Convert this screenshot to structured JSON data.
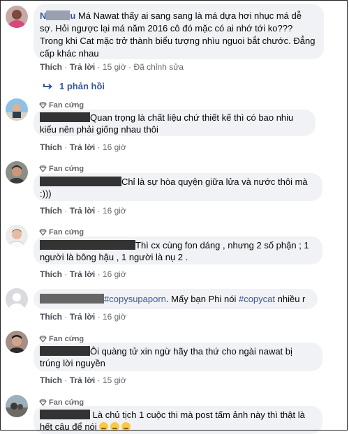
{
  "comments": [
    {
      "text": "Má Nawat thấy ai sang sang là má dựa hơi nhục má dễ sợ. Hỏi ngược lại má năm 2016 cô đó mặc có ai nhớ tới ko??? Trong khi Cat mặc trở thành biểu tượng nhìu nguoi bắt chước. Đẳng cấp khác nhau",
      "name_prefix": "N",
      "name_suffix": "u",
      "like": "Thích",
      "reply": "Trả lời",
      "time": "15 giờ",
      "edited": "Đã chỉnh sửa",
      "reply_count": "1 phản hồi"
    },
    {
      "badge": "Fan cứng",
      "text": "Quan trọng là chất liệu chứ thiết kế thì có bao nhiu kiểu nên phải giống nhau thôi",
      "like": "Thích",
      "reply": "Trả lời",
      "time": "16 giờ"
    },
    {
      "badge": "Fan cứng",
      "text": "Chỉ là sự hòa quyện giữa lửa và nước thôi mà :)))",
      "like": "Thích",
      "reply": "Trả lời",
      "time": "16 giờ"
    },
    {
      "badge": "Fan cứng",
      "text": "Thì cx cùng fon dáng , nhưng 2 số phận ; 1 người là bông hậu , 1 người là nụ 2 .",
      "like": "Thích",
      "reply": "Trả lời",
      "time": "16 giờ"
    },
    {
      "hashtag1": "#copysupaporn",
      "text_mid": ". Mấy bạn Phi nói ",
      "hashtag2": "#copycat",
      "text_end": " nhiều r",
      "like": "Thích",
      "reply": "Trả lời",
      "time": "16 giờ"
    },
    {
      "badge": "Fan cứng",
      "text": "Ôi quàng tử xin ngừ hãy tha thứ cho ngài nawat bị trúng lời nguyền",
      "like": "Thích",
      "reply": "Trả lời",
      "time": "15 giờ"
    },
    {
      "badge": "Fan cứng",
      "text": "Là chủ tịch 1 cuộc thi mà post tấm ảnh này thì thật là hết câu để nói"
    }
  ],
  "separator": "·",
  "colors": {
    "bubble": "#f0f2f5",
    "link": "#385898",
    "meta": "#65676b"
  }
}
